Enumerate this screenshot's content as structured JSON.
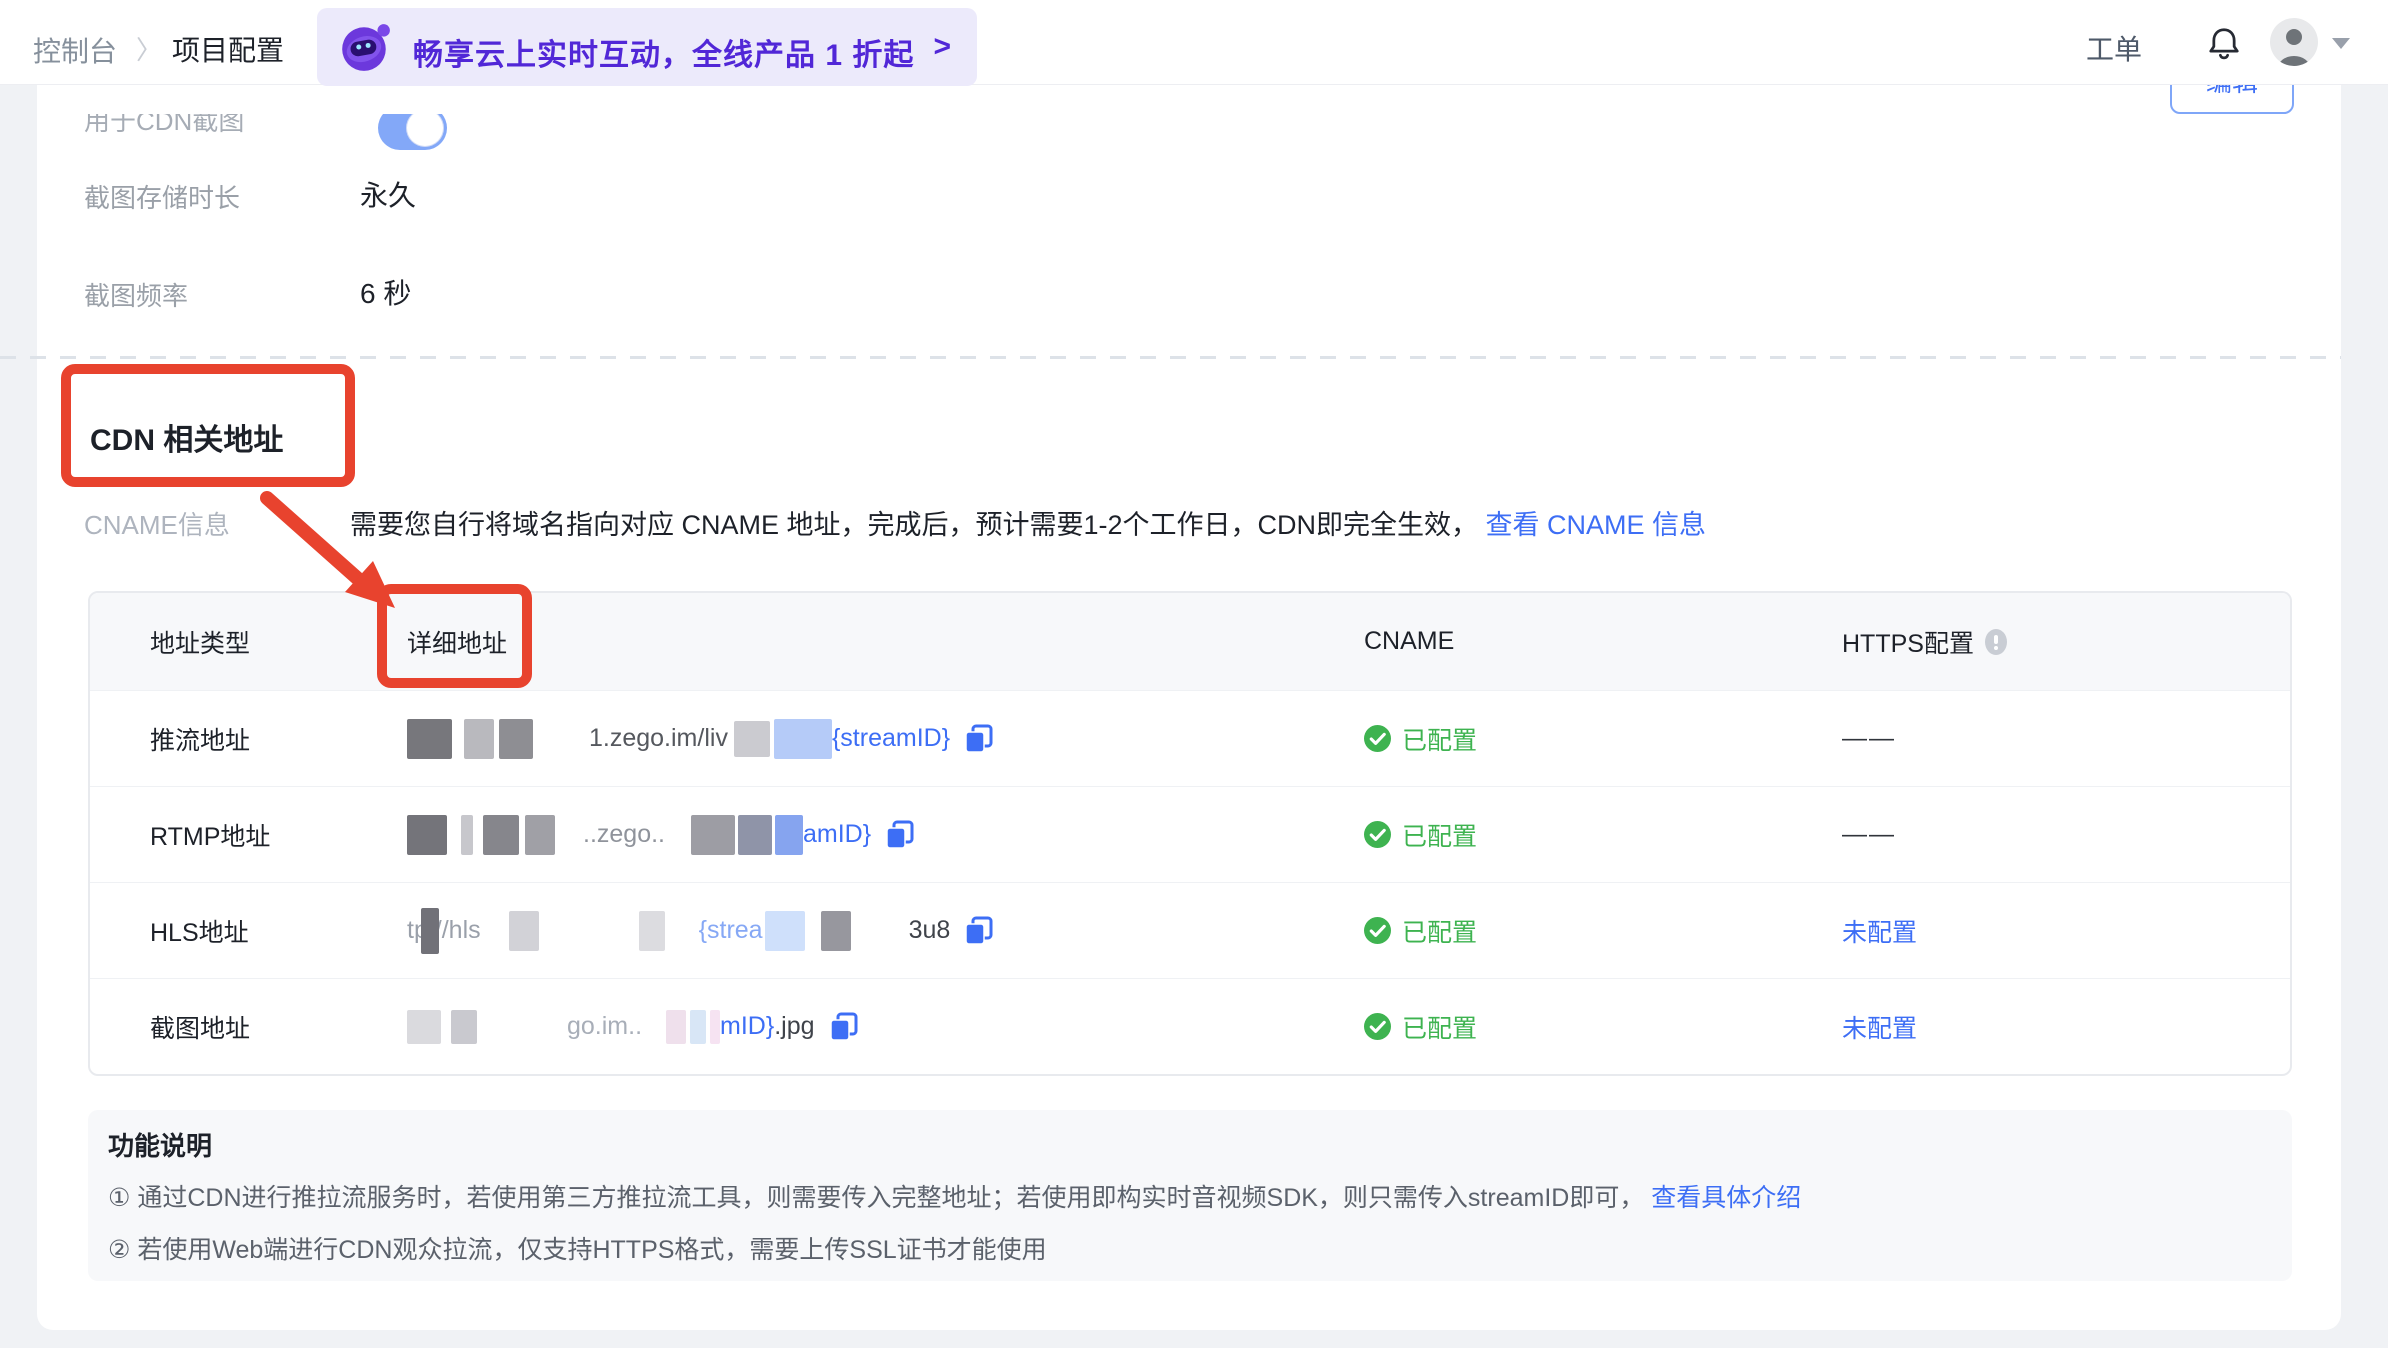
{
  "topbar": {
    "breadcrumb": {
      "root": "控制台",
      "separator": "〉",
      "current": "项目配置"
    },
    "banner": {
      "text": "畅享云上实时互动，全线产品 1 折起",
      "arrow": ">"
    },
    "ticket_label": "工单",
    "icons": [
      "bell-icon",
      "avatar",
      "caret-down-icon"
    ]
  },
  "edit_button_label": "编辑",
  "settings": {
    "rows": [
      {
        "label": "用于CDN截图",
        "control": "toggle-on"
      },
      {
        "label": "截图存储时长",
        "value": "永久"
      },
      {
        "label": "截图频率",
        "value": "6 秒"
      }
    ]
  },
  "section": {
    "title": "CDN 相关地址"
  },
  "cname_info": {
    "label": "CNAME信息",
    "text": "需要您自行将域名指向对应 CNAME 地址，完成后，预计需要1-2个工作日，CDN即完全生效，",
    "link": "查看 CNAME 信息"
  },
  "table": {
    "headers": {
      "type": "地址类型",
      "detail": "详细地址",
      "cname": "CNAME",
      "https": "HTTPS配置"
    },
    "rows": [
      {
        "type": "推流地址",
        "url_pre": "1.zego.im/liv",
        "url_link": "{streamID}",
        "url_post": "",
        "cname": "已配置",
        "https": "——"
      },
      {
        "type": "RTMP地址",
        "url_pre": "..zego..",
        "url_link": "amID}",
        "url_post": "",
        "cname": "已配置",
        "https": "——"
      },
      {
        "type": "HLS地址",
        "url_pre": "tp://hls",
        "url_link": "{strea",
        "url_post": "3u8",
        "cname": "已配置",
        "https": "未配置"
      },
      {
        "type": "截图地址",
        "url_pre": "go.im..",
        "url_link": "mID}",
        "url_post": ".jpg",
        "cname": "已配置",
        "https": "未配置"
      }
    ]
  },
  "notes": {
    "title": "功能说明",
    "item1": "① 通过CDN进行推拉流服务时，若使用第三方推拉流工具，则需要传入完整地址；若使用即构实时音视频SDK，则只需传入streamID即可，",
    "item1_link": "查看具体介绍",
    "item2": "② 若使用Web端进行CDN观众拉流，仅支持HTTPS格式，需要上传SSL证书才能使用"
  },
  "colors": {
    "accent_blue": "#3D6EF5",
    "success_green": "#3EB350",
    "annotation_red": "#E8432E",
    "banner_purple": "#5127D7"
  }
}
